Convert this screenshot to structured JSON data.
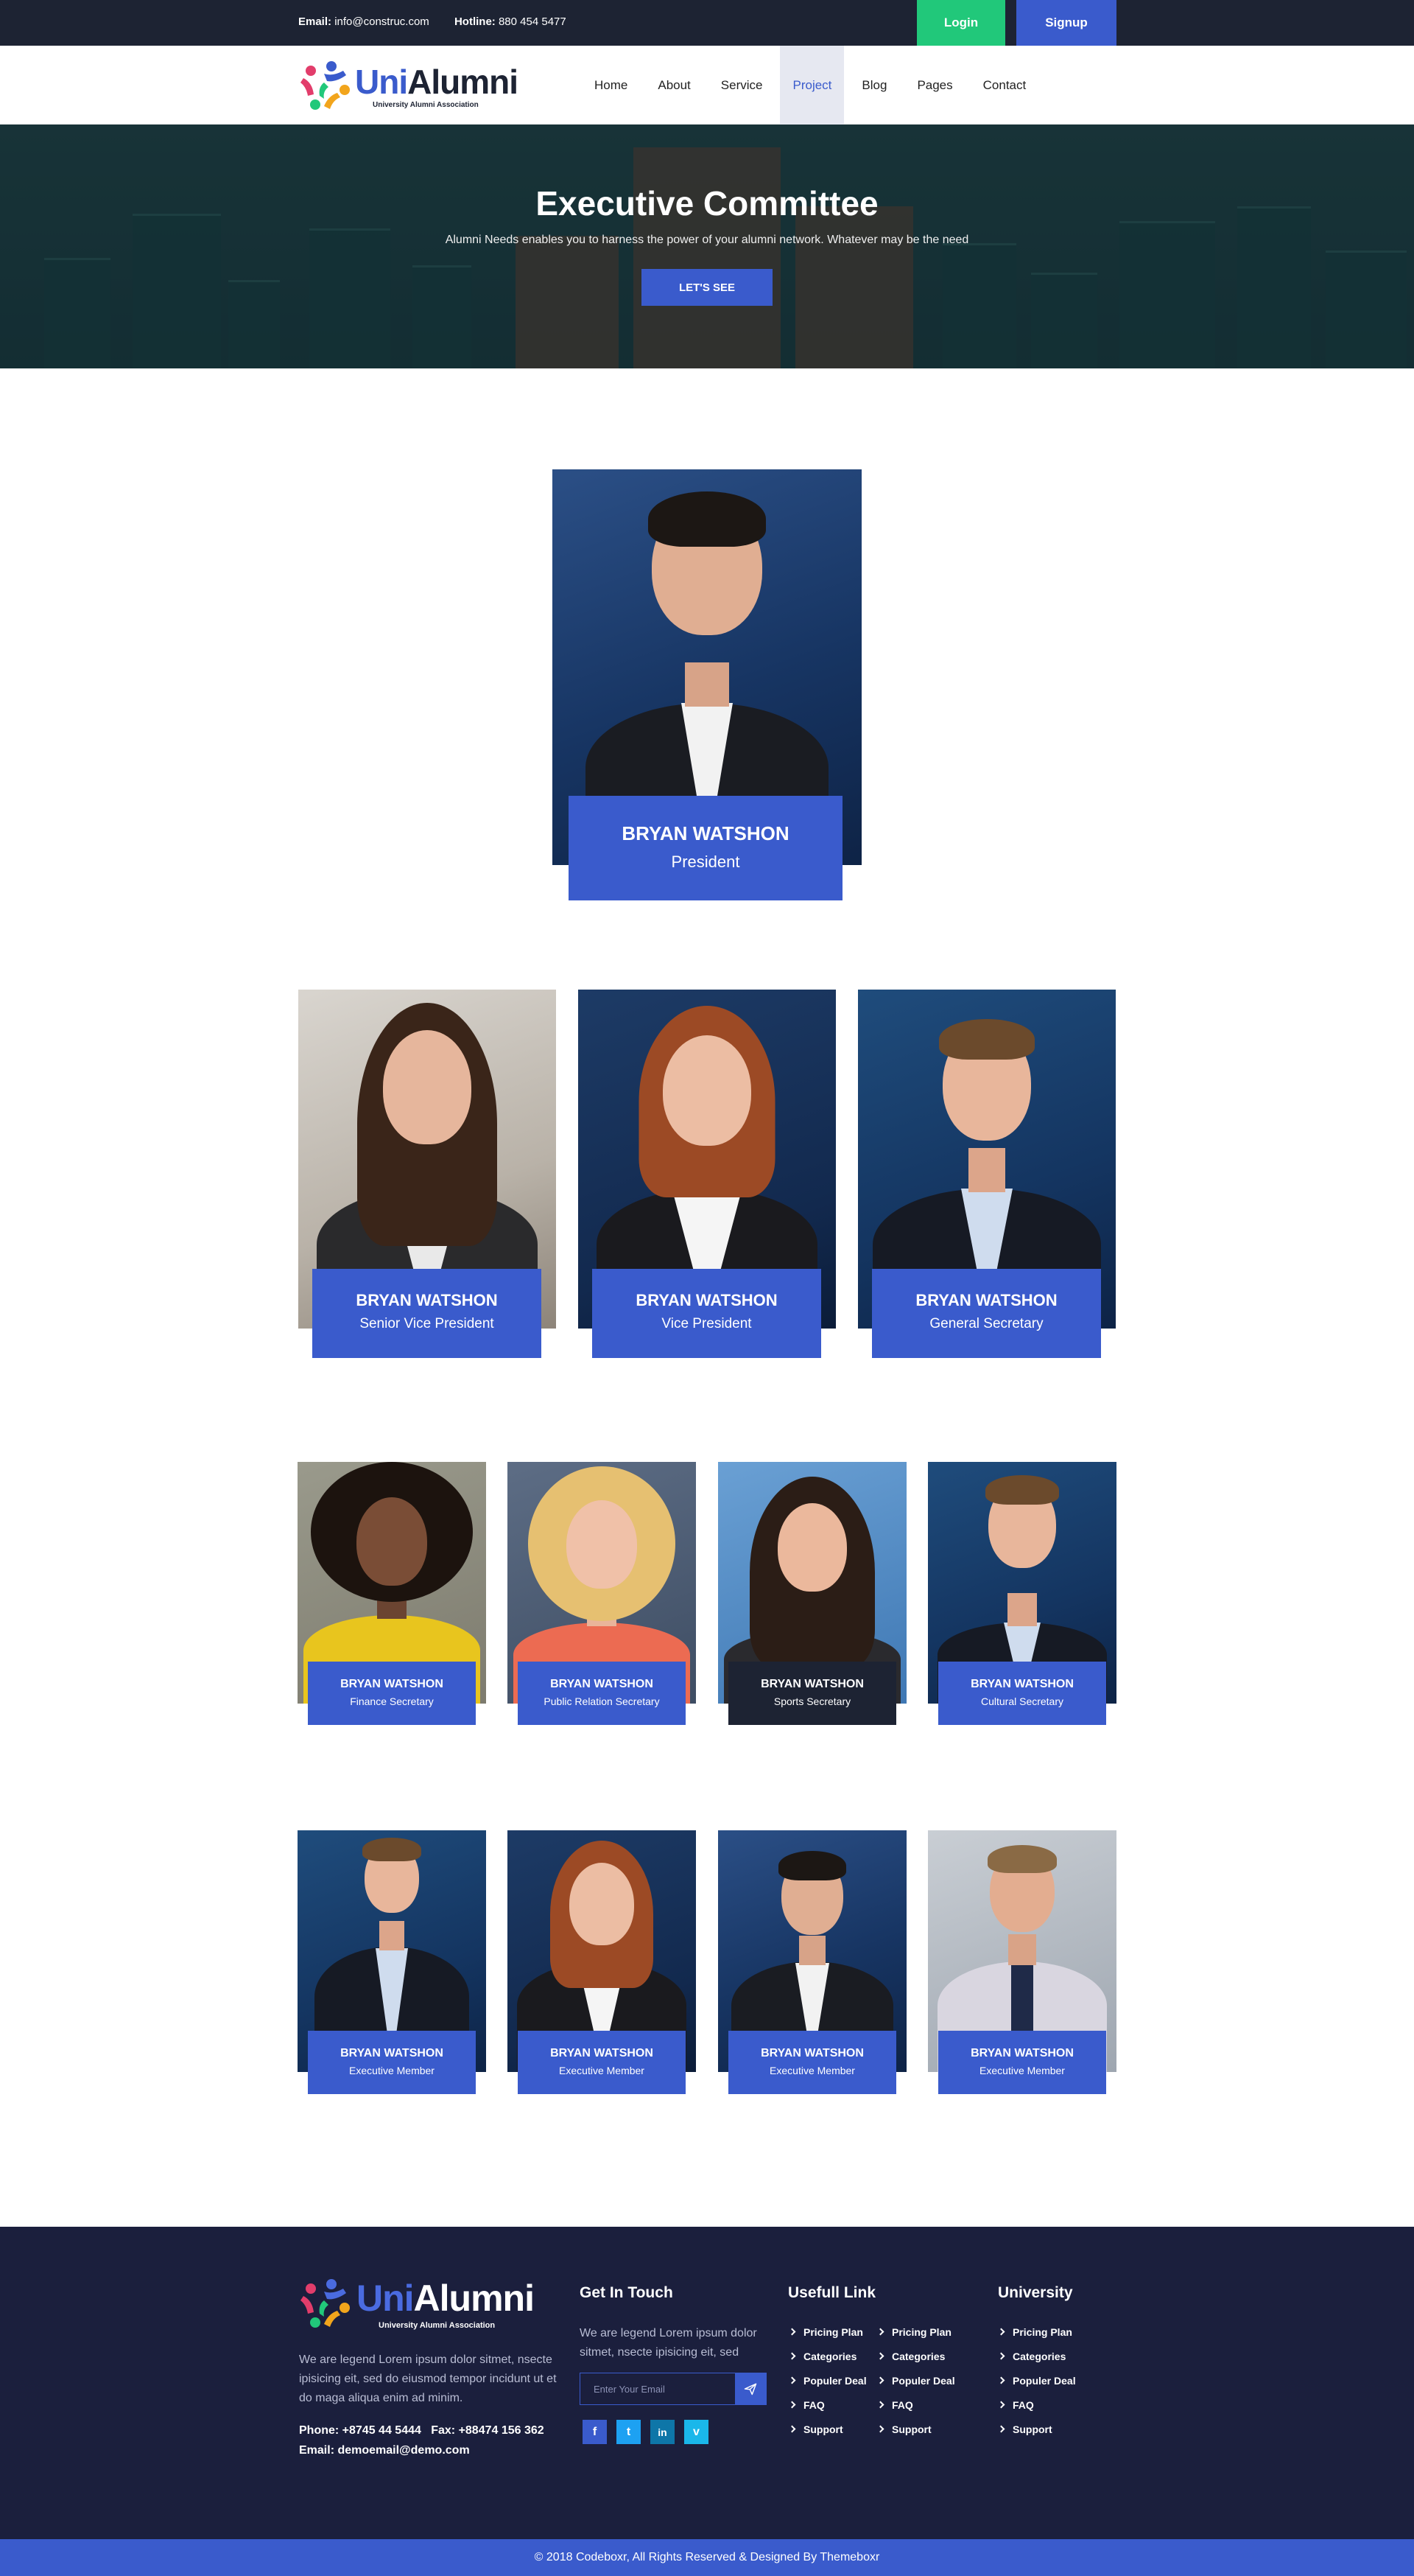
{
  "topbar": {
    "email_label": "Email:",
    "email_value": "info@construc.com",
    "hotline_label": "Hotline:",
    "hotline_value": "880 454 5477",
    "login_label": "Login",
    "signup_label": "Signup"
  },
  "brand": {
    "name_part1": "Uni",
    "name_part2": "Alumni",
    "tagline": "University Alumni Association"
  },
  "nav": {
    "items": [
      "Home",
      "About",
      "Service",
      "Project",
      "Blog",
      "Pages",
      "Contact"
    ],
    "active": "Project"
  },
  "hero": {
    "title": "Executive Committee",
    "subtitle": "Alumni Needs enables you to harness the power of your alumni network. Whatever may be the need",
    "cta_label": "LET'S SEE"
  },
  "members": {
    "president": {
      "name": "BRYAN WATSHON",
      "role": "President"
    },
    "row2": [
      {
        "name": "BRYAN WATSHON",
        "role": "Senior Vice President"
      },
      {
        "name": "BRYAN WATSHON",
        "role": "Vice President"
      },
      {
        "name": "BRYAN WATSHON",
        "role": "General Secretary"
      }
    ],
    "row3": [
      {
        "name": "BRYAN WATSHON",
        "role": "Finance Secretary"
      },
      {
        "name": "BRYAN WATSHON",
        "role": "Public Relation Secretary"
      },
      {
        "name": "BRYAN WATSHON",
        "role": "Sports Secretary"
      },
      {
        "name": "BRYAN WATSHON",
        "role": "Cultural Secretary"
      }
    ],
    "row4": [
      {
        "name": "BRYAN WATSHON",
        "role": "Executive Member"
      },
      {
        "name": "BRYAN WATSHON",
        "role": "Executive Member"
      },
      {
        "name": "BRYAN WATSHON",
        "role": "Executive Member"
      },
      {
        "name": "BRYAN WATSHON",
        "role": "Executive Member"
      }
    ]
  },
  "footer": {
    "about": "We are legend Lorem ipsum dolor sitmet, nsecte ipisicing eit, sed do eiusmod tempor incidunt ut et do maga aliqua enim ad minim.",
    "phone": "Phone: +8745 44 5444   Fax: +88474 156 362",
    "email": "Email: demoemail@demo.com",
    "get_in_touch": {
      "title": "Get In Touch",
      "text": "We are legend Lorem ipsum dolor sitmet, nsecte ipisicing eit, sed",
      "placeholder": "Enter Your Email"
    },
    "socials": [
      "f",
      "t",
      "in",
      "v"
    ],
    "useful_links": {
      "title": "Usefull Link",
      "col1": [
        "Pricing Plan",
        "Categories",
        "Populer Deal",
        "FAQ",
        "Support"
      ],
      "col2": [
        "Pricing Plan",
        "Categories",
        "Populer Deal",
        "FAQ",
        "Support"
      ]
    },
    "university": {
      "title": "University",
      "items": [
        "Pricing Plan",
        "Categories",
        "Populer Deal",
        "FAQ",
        "Support"
      ]
    },
    "copyright": "© 2018 Codeboxr, All Rights Reserved & Designed By Themeboxr"
  },
  "colors": {
    "accent": "#3a5bcc",
    "green": "#21c87a",
    "dark": "#1d2333",
    "footer_bg": "#1b1f3d"
  }
}
